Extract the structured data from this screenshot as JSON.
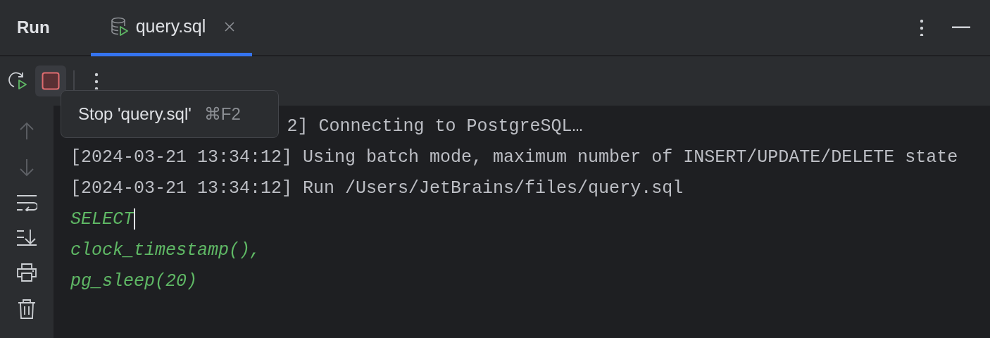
{
  "panel": {
    "title": "Run"
  },
  "tabs": [
    {
      "label": "query.sql",
      "selected": true,
      "closable": true
    }
  ],
  "toolbar": {
    "stop_tooltip": {
      "text": "Stop 'query.sql'",
      "shortcut": "⌘F2"
    }
  },
  "console": {
    "lines": [
      {
        "kind": "log_hidden_start",
        "text": "2] Connecting to PostgreSQL…"
      },
      {
        "kind": "log",
        "text": "[2024-03-21 13:34:12] Using batch mode, maximum number of INSERT/UPDATE/DELETE state"
      },
      {
        "kind": "log",
        "text": "[2024-03-21 13:34:12] Run /Users/JetBrains/files/query.sql"
      },
      {
        "kind": "sql",
        "text": "SELECT",
        "caret": true
      },
      {
        "kind": "sql",
        "text": "clock_timestamp(),"
      },
      {
        "kind": "sql",
        "text": "pg_sleep(20)"
      }
    ]
  }
}
